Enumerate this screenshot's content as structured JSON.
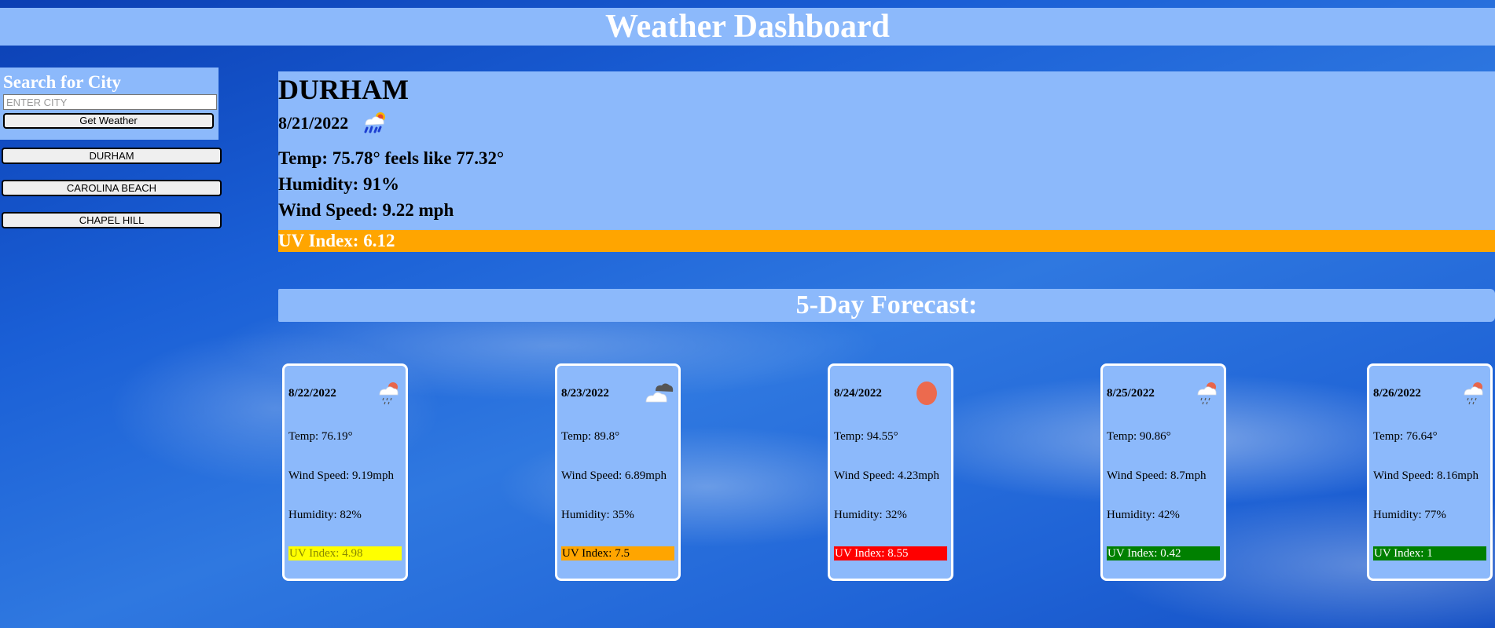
{
  "header": {
    "title": "Weather Dashboard"
  },
  "search": {
    "title": "Search for City",
    "placeholder": "ENTER CITY",
    "button_label": "Get Weather"
  },
  "history": [
    "DURHAM",
    "CAROLINA BEACH",
    "CHAPEL HILL"
  ],
  "current": {
    "city": "DURHAM",
    "date": "8/21/2022",
    "icon": "rain-sun-icon",
    "temp": "Temp: 75.78° feels like 77.32°",
    "humidity": "Humidity: 91%",
    "wind": "Wind Speed: 9.22 mph",
    "uv": "UV Index: 6.12",
    "uv_color": "#ffa500"
  },
  "forecast": {
    "title": "5-Day Forecast:",
    "days": [
      {
        "date": "8/22/2022",
        "icon": "rain-cloud-sun-icon",
        "temp": "Temp: 76.19°",
        "wind": "Wind Speed: 9.19mph",
        "humidity": "Humidity: 82%",
        "uv": "UV Index: 4.98",
        "uv_color": "#ffff00"
      },
      {
        "date": "8/23/2022",
        "icon": "clouds-icon",
        "temp": "Temp: 89.8°",
        "wind": "Wind Speed: 6.89mph",
        "humidity": "Humidity: 35%",
        "uv": "UV Index: 7.5",
        "uv_color": "#ffa500"
      },
      {
        "date": "8/24/2022",
        "icon": "sun-icon",
        "temp": "Temp: 94.55°",
        "wind": "Wind Speed: 4.23mph",
        "humidity": "Humidity: 32%",
        "uv": "UV Index: 8.55",
        "uv_color": "#ff0000"
      },
      {
        "date": "8/25/2022",
        "icon": "rain-cloud-sun-icon",
        "temp": "Temp: 90.86°",
        "wind": "Wind Speed: 8.7mph",
        "humidity": "Humidity: 42%",
        "uv": "UV Index: 0.42",
        "uv_color": "#008000"
      },
      {
        "date": "8/26/2022",
        "icon": "rain-cloud-sun-icon",
        "temp": "Temp: 76.64°",
        "wind": "Wind Speed: 8.16mph",
        "humidity": "Humidity: 77%",
        "uv": "UV Index: 1",
        "uv_color": "#008000"
      }
    ]
  }
}
